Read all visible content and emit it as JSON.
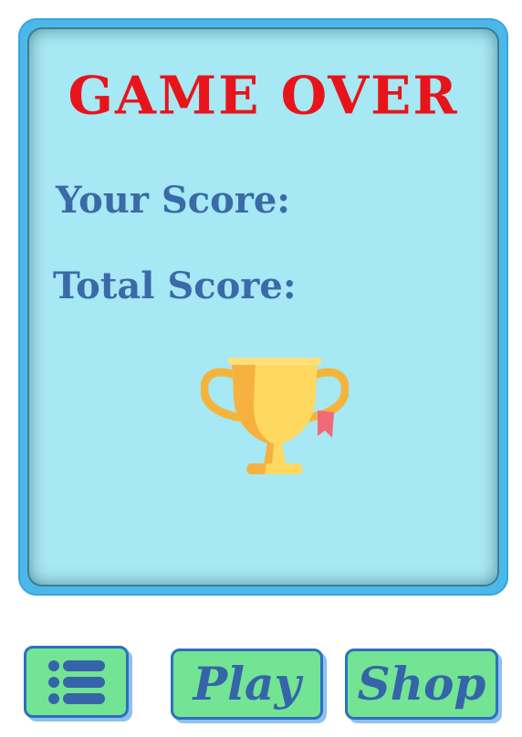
{
  "title": "GAME OVER",
  "labels": {
    "your_score": "Your Score:",
    "total_score": "Total Score:"
  },
  "icons": {
    "trophy": "trophy-icon",
    "menu": "list-menu-icon"
  },
  "buttons": {
    "play": "Play",
    "shop": "Shop"
  },
  "colors": {
    "panel_border": "#4cb8ea",
    "panel_fill": "#a6e8f3",
    "title": "#e8141b",
    "label": "#3a6aa8",
    "button_fill": "#73e493",
    "button_border": "#2d6fc1"
  }
}
